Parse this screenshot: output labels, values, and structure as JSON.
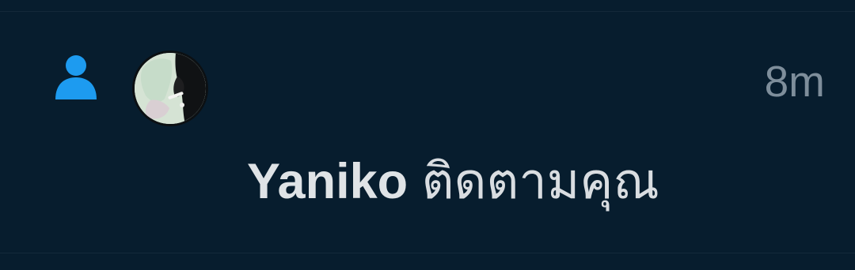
{
  "notification": {
    "type_icon": "person-icon",
    "avatar_icon": "user-avatar",
    "timestamp": "8m",
    "user_name": "Yaniko",
    "action_text": "ติดตามคุณ"
  },
  "colors": {
    "background": "#071d2e",
    "accent": "#1d9bf0",
    "text": "#d9dde1",
    "muted": "#7e8e9b",
    "divider": "#14293a"
  }
}
